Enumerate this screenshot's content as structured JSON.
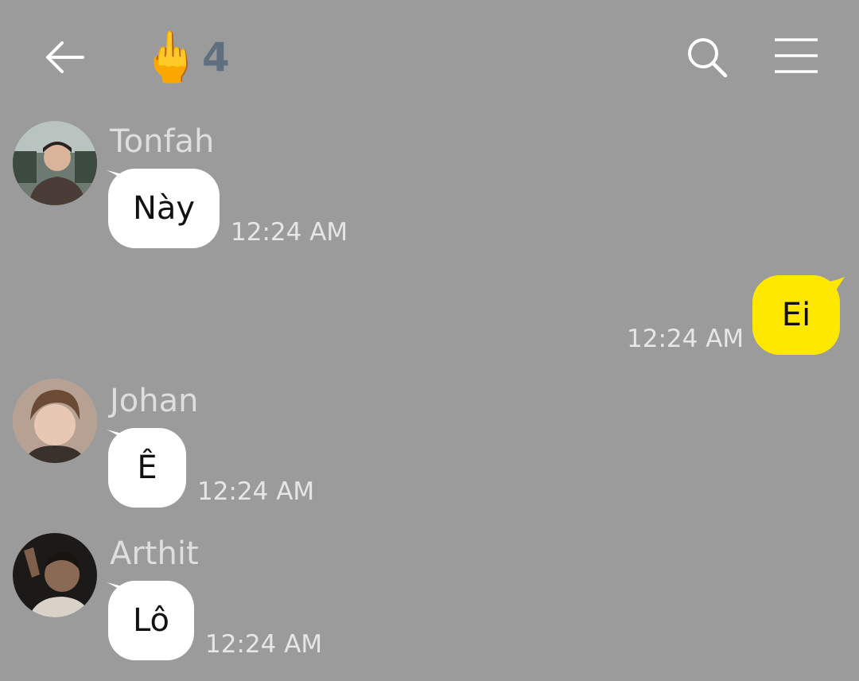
{
  "header": {
    "title_emoji": "🖕",
    "title_count": "4",
    "icons": {
      "back": "arrow-left-icon",
      "search": "search-icon",
      "menu": "hamburger-menu-icon"
    }
  },
  "colors": {
    "background": "#9b9b9b",
    "incoming_bubble": "#ffffff",
    "outgoing_bubble": "#fee800",
    "timestamp": "#e6e6e6",
    "sender_name": "#dedede"
  },
  "messages": [
    {
      "sender": "Tonfah",
      "text": "Này",
      "time": "12:24 AM",
      "direction": "incoming"
    },
    {
      "sender": "",
      "text": "Ei",
      "time": "12:24 AM",
      "direction": "outgoing"
    },
    {
      "sender": "Johan",
      "text": "Ê",
      "time": "12:24 AM",
      "direction": "incoming"
    },
    {
      "sender": "Arthit",
      "text": "Lô",
      "time": "12:24 AM",
      "direction": "incoming"
    }
  ]
}
